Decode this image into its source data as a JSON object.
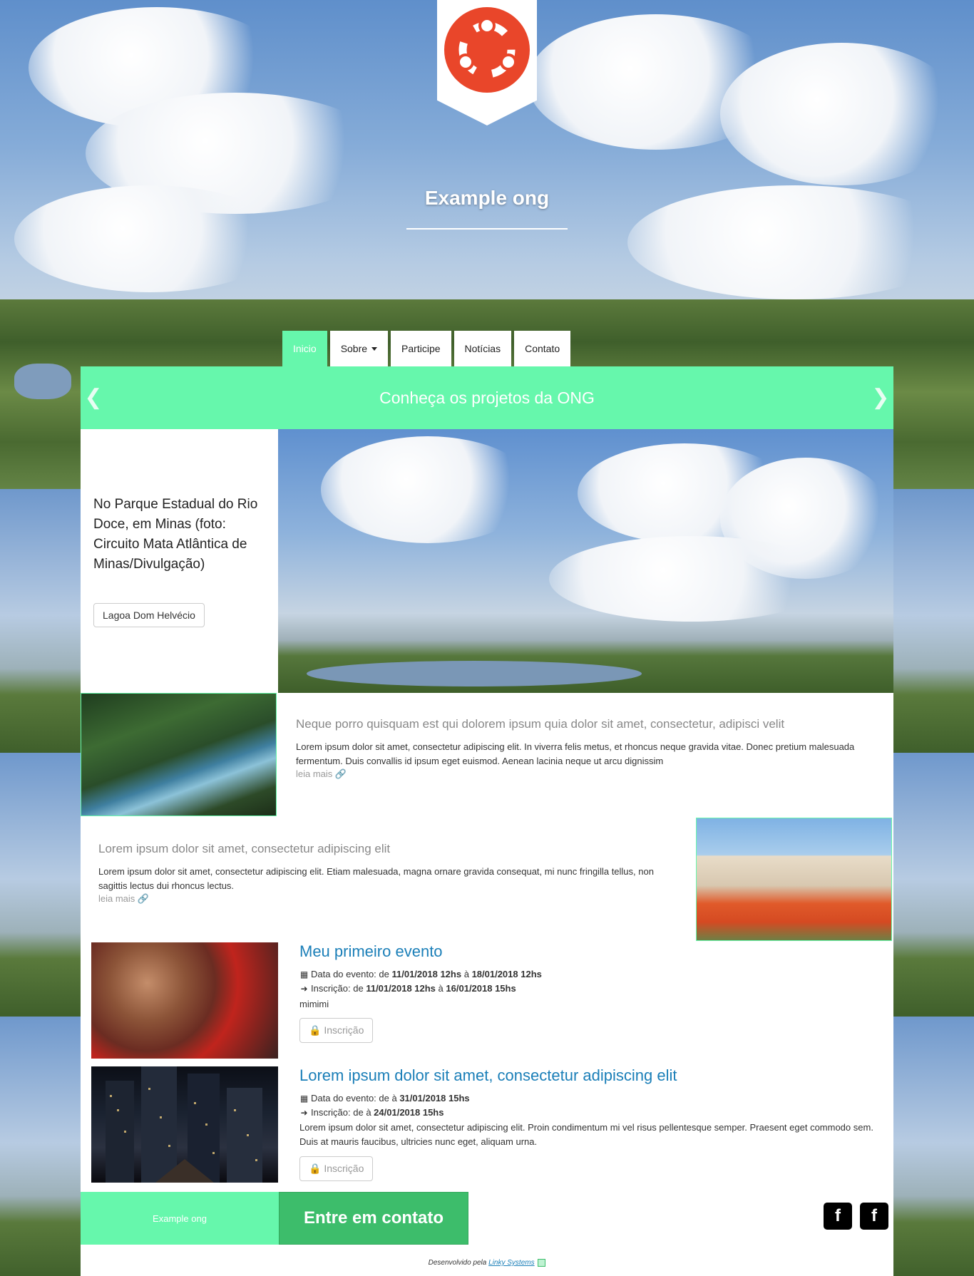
{
  "header": {
    "site_title": "Example ong",
    "logo_icon": "ubuntu-logo-icon",
    "accent_color": "#66f7ac",
    "logo_color": "#e9462a"
  },
  "nav": {
    "items": [
      {
        "label": "Inicio",
        "active": true
      },
      {
        "label": "Sobre",
        "dropdown": true
      },
      {
        "label": "Participe"
      },
      {
        "label": "Notícias"
      },
      {
        "label": "Contato"
      }
    ]
  },
  "carousel": {
    "heading": "Conheça os projetos da ONG",
    "prev_icon": "chevron-left-icon",
    "next_icon": "chevron-right-icon",
    "caption": "No Parque Estadual do Rio Doce, em Minas (foto: Circuito Mata Atlântica de Minas/Divulgação)",
    "button_label": "Lagoa Dom Helvécio"
  },
  "features": [
    {
      "title": "Neque porro quisquam est qui dolorem ipsum quia dolor sit amet, consectetur, adipisci velit",
      "text": "Lorem ipsum dolor sit amet, consectetur adipiscing elit. In viverra felis metus, et rhoncus neque gravida vitae. Donec pretium malesuada fermentum. Duis convallis id ipsum eget euismod. Aenean lacinia neque ut arcu dignissim",
      "link": "leia mais"
    },
    {
      "title": "Lorem ipsum dolor sit amet, consectetur adipiscing elit",
      "text": "Lorem ipsum dolor sit amet, consectetur adipiscing elit. Etiam malesuada, magna ornare gravida consequat, mi nunc fringilla tellus, non sagittis lectus dui rhoncus lectus.",
      "link": "leia mais"
    }
  ],
  "events": [
    {
      "title": "Meu primeiro evento",
      "date_label": "Data do evento: de",
      "date_start": "11/01/2018 12hs",
      "date_sep": "à",
      "date_end": "18/01/2018 12hs",
      "reg_label": "Inscrição: de",
      "reg_start": "11/01/2018 12hs",
      "reg_sep": "à",
      "reg_end": "16/01/2018 15hs",
      "description": "mimimi",
      "button_label": "Inscrição"
    },
    {
      "title": "Lorem ipsum dolor sit amet, consectetur adipiscing elit",
      "date_label": "Data do evento: de à",
      "date_value": "31/01/2018 15hs",
      "reg_label": "Inscrição: de à",
      "reg_value": "24/01/2018 15hs",
      "description": "Lorem ipsum dolor sit amet, consectetur adipiscing elit. Proin condimentum mi vel risus pellentesque semper. Praesent eget commodo sem. Duis at mauris faucibus, ultricies nunc eget, aliquam urna.",
      "button_label": "Inscrição"
    }
  ],
  "footer": {
    "brand": "Example ong",
    "contact_label": "Entre em contato",
    "social": [
      "f",
      "f"
    ],
    "credit_prefix": "Desenvolvido pela",
    "credit_link": "Linky Systems"
  }
}
